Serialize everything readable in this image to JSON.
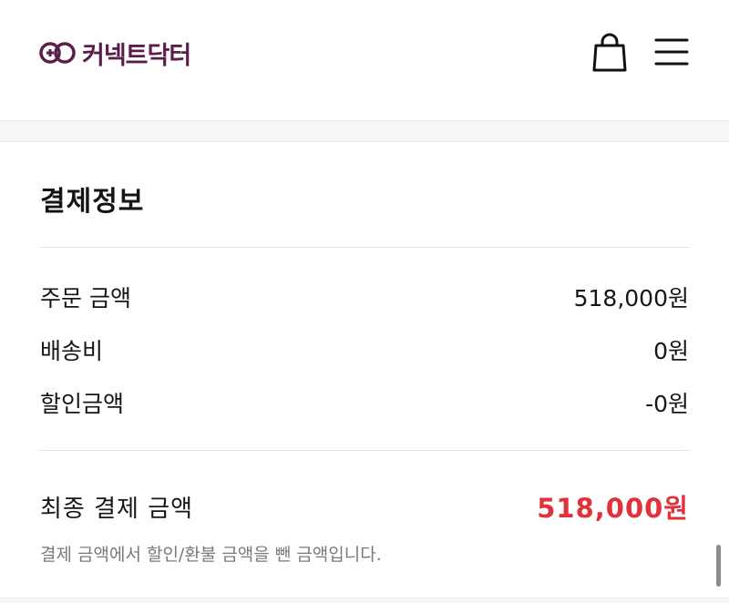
{
  "header": {
    "logo_text": "커넥트닥터",
    "brand_color": "#5b1e4a",
    "icons": [
      "shopping-bag-icon",
      "hamburger-menu-icon"
    ]
  },
  "payment": {
    "title": "결제정보",
    "rows": [
      {
        "label": "주문 금액",
        "value": "518,000원"
      },
      {
        "label": "배송비",
        "value": "0원"
      },
      {
        "label": "할인금액",
        "value": "-0원"
      }
    ],
    "final": {
      "label": "최종 결제 금액",
      "value": "518,000원",
      "color": "#e0323c"
    },
    "note": "결제 금액에서 할인/환불 금액을 뺀 금액입니다."
  }
}
